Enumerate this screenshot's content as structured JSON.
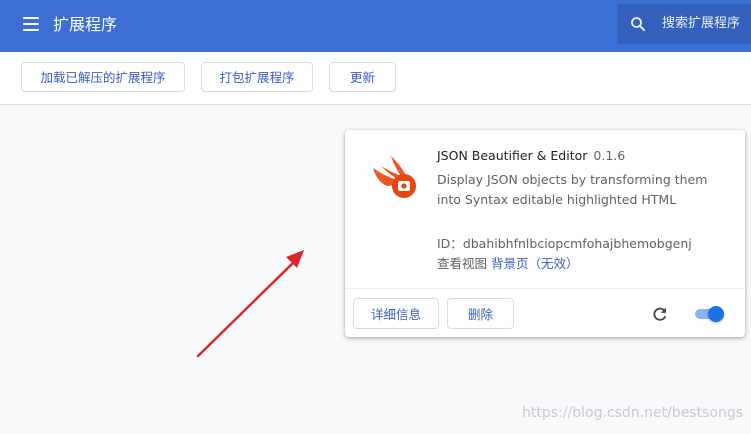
{
  "header": {
    "title": "扩展程序",
    "search_placeholder": "搜索扩展程序"
  },
  "toolbar": {
    "load_unpacked": "加载已解压的扩展程序",
    "pack": "打包扩展程序",
    "update": "更新"
  },
  "extension": {
    "name": "JSON Beautifier & Editor",
    "version": "0.1.6",
    "description": "Display JSON objects by transforming them into Syntax editable highlighted HTML",
    "id_label": "ID：",
    "id": "dbahibhfnlbciopcmfohajbhemobgenj",
    "views_label": "查看视图",
    "view_link": "背景页",
    "view_status": "（无效）",
    "details_button": "详细信息",
    "remove_button": "删除",
    "enabled": true,
    "icon": "swift-bird-icon"
  },
  "watermark": "https://blog.csdn.net/bestsongs",
  "colors": {
    "header": "#3b6fd6",
    "accent": "#3c5ec7",
    "toggle": "#1a73e8",
    "arrow": "#e0242a"
  }
}
